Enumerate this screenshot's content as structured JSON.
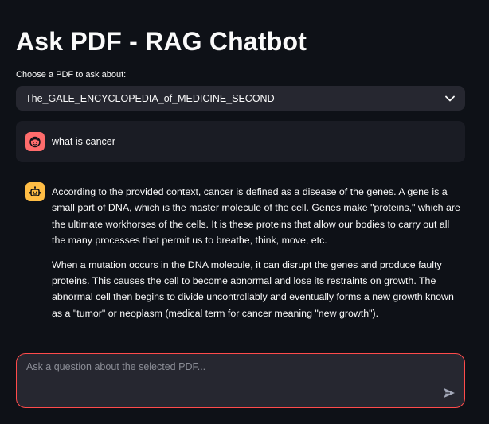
{
  "header": {
    "title": "Ask PDF - RAG Chatbot"
  },
  "pdf_select": {
    "label": "Choose a PDF to ask about:",
    "selected": "The_GALE_ENCYCLOPEDIA_of_MEDICINE_SECOND"
  },
  "chat": {
    "user_message": "what is cancer",
    "assistant_paragraphs": [
      "According to the provided context, cancer is defined as a disease of the genes. A gene is a small part of DNA, which is the master molecule of the cell. Genes make \"proteins,\" which are the ultimate workhorses of the cells. It is these proteins that allow our bodies to carry out all the many processes that permit us to breathe, think, move, etc.",
      "When a mutation occurs in the DNA molecule, it can disrupt the genes and produce faulty proteins. This causes the cell to become abnormal and lose its restraints on growth. The abnormal cell then begins to divide uncontrollably and eventually forms a new growth known as a \"tumor\" or neoplasm (medical term for cancer meaning \"new growth\")."
    ]
  },
  "input": {
    "placeholder": "Ask a question about the selected PDF..."
  },
  "colors": {
    "background": "#0e1117",
    "user_avatar": "#ff6c6c",
    "assistant_avatar": "#ffbd45",
    "input_border": "#ff4b4b"
  },
  "icons": {
    "user_avatar": "user-face-icon",
    "assistant_avatar": "robot-icon",
    "dropdown": "chevron-down-icon",
    "send": "send-icon"
  }
}
